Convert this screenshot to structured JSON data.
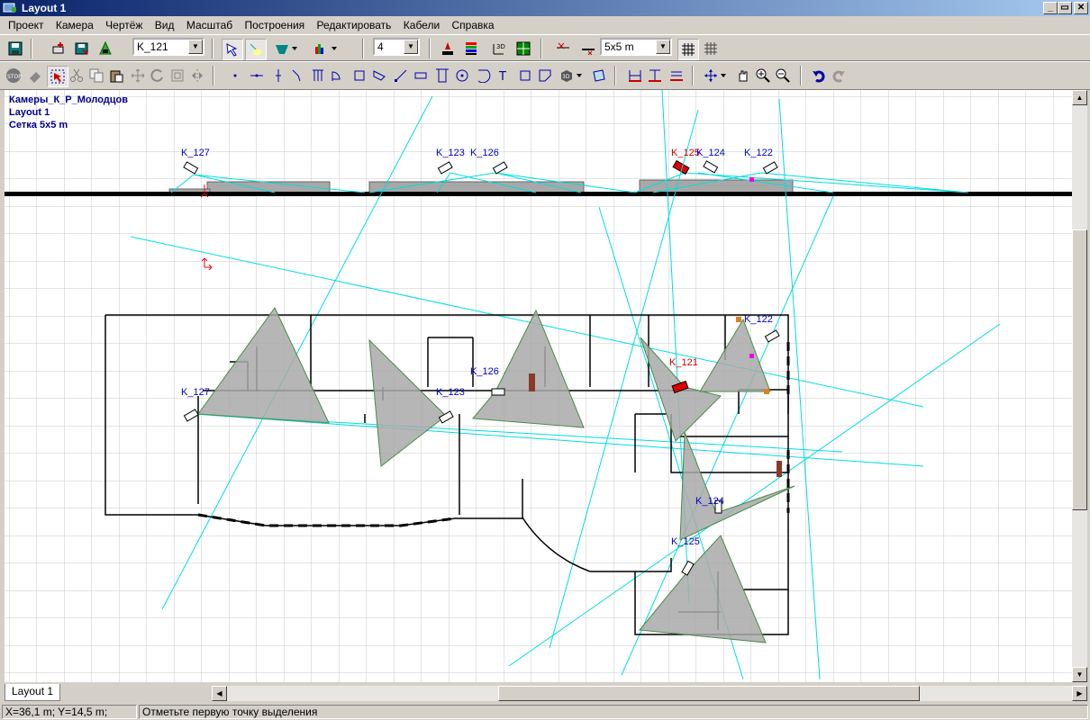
{
  "window": {
    "title": "Layout 1",
    "buttons": {
      "minimize": "_",
      "restore": "▭",
      "close": "✕"
    }
  },
  "menu": [
    "Проект",
    "Камера",
    "Чертёж",
    "Вид",
    "Масштаб",
    "Построения",
    "Редактировать",
    "Кабели",
    "Справка"
  ],
  "toolbar": {
    "camera_select": "K_121",
    "number_select": "4",
    "grid_select": "5x5 m"
  },
  "canvas": {
    "project_title": "Камеры_К_Р_Молодцов",
    "layout_name": "Layout 1",
    "grid_info": "Сетка 5x5 m",
    "camera_labels_elevation": [
      "K_127",
      "K_123",
      "K_126",
      "K_125",
      "K_124",
      "K_122"
    ],
    "camera_labels_plan": [
      "K_127",
      "K_123",
      "K_126",
      "K_121",
      "K_122",
      "K_124",
      "K_125"
    ],
    "colors": {
      "view_line": "#00dede",
      "cone_fill": "#a9a9a9",
      "label": "#0000cc",
      "selected": "#cc0000"
    }
  },
  "tabs": [
    "Layout 1"
  ],
  "status": {
    "coords": "X=36,1 m; Y=14,5 m;",
    "message": "Отметьте первую точку выделения"
  }
}
